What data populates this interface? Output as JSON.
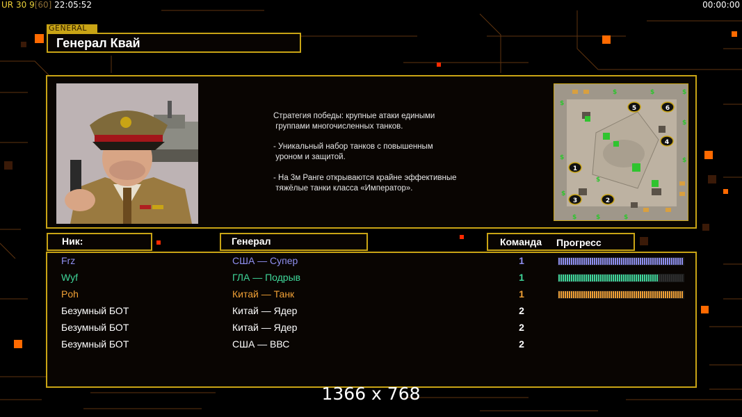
{
  "status_bar": {
    "ur": "UR",
    "n1": "30",
    "n2": "9",
    "bracket_value": "[60]",
    "clock": "22:05:52",
    "timer": "00:00:00"
  },
  "general_panel": {
    "tag": "GENERAL",
    "name": "Генерал Квай",
    "description": "Стратегия победы: крупные атаки едиными\n группами многочисленных танков.\n\n- Уникальный набор танков с повышенным\n уроном и защитой.\n\n- На 3м Ранге открываются крайне эффективные\n тяжёлые танки класса «Император»."
  },
  "minimap": {
    "start_positions": [
      "1",
      "2",
      "3",
      "4",
      "5",
      "6"
    ]
  },
  "columns": {
    "nick": "Ник:",
    "general": "Генерал",
    "team": "Команда",
    "progress": "Прогресс"
  },
  "players": [
    {
      "nick": "Frz",
      "general": "США — Супер",
      "team": "1",
      "color": "#8f8ff0",
      "progress": 1.0
    },
    {
      "nick": "Wyf",
      "general": "ГЛА — Подрыв",
      "team": "1",
      "color": "#3fd79a",
      "progress": 0.8
    },
    {
      "nick": "Poh",
      "general": "Китай — Танк",
      "team": "1",
      "color": "#f0a035",
      "progress": 1.0
    },
    {
      "nick": "Безумный БОТ",
      "general": "Китай — Ядер",
      "team": "2",
      "color": "#ffffff",
      "progress": null
    },
    {
      "nick": "Безумный БОТ",
      "general": "Китай — Ядер",
      "team": "2",
      "color": "#ffffff",
      "progress": null
    },
    {
      "nick": "Безумный БОТ",
      "general": "США — ВВС",
      "team": "2",
      "color": "#ffffff",
      "progress": null
    }
  ],
  "resolution_label": "1366 x 768",
  "colors": {
    "frame": "#c9a415",
    "accent_orange": "#ff6a00"
  }
}
